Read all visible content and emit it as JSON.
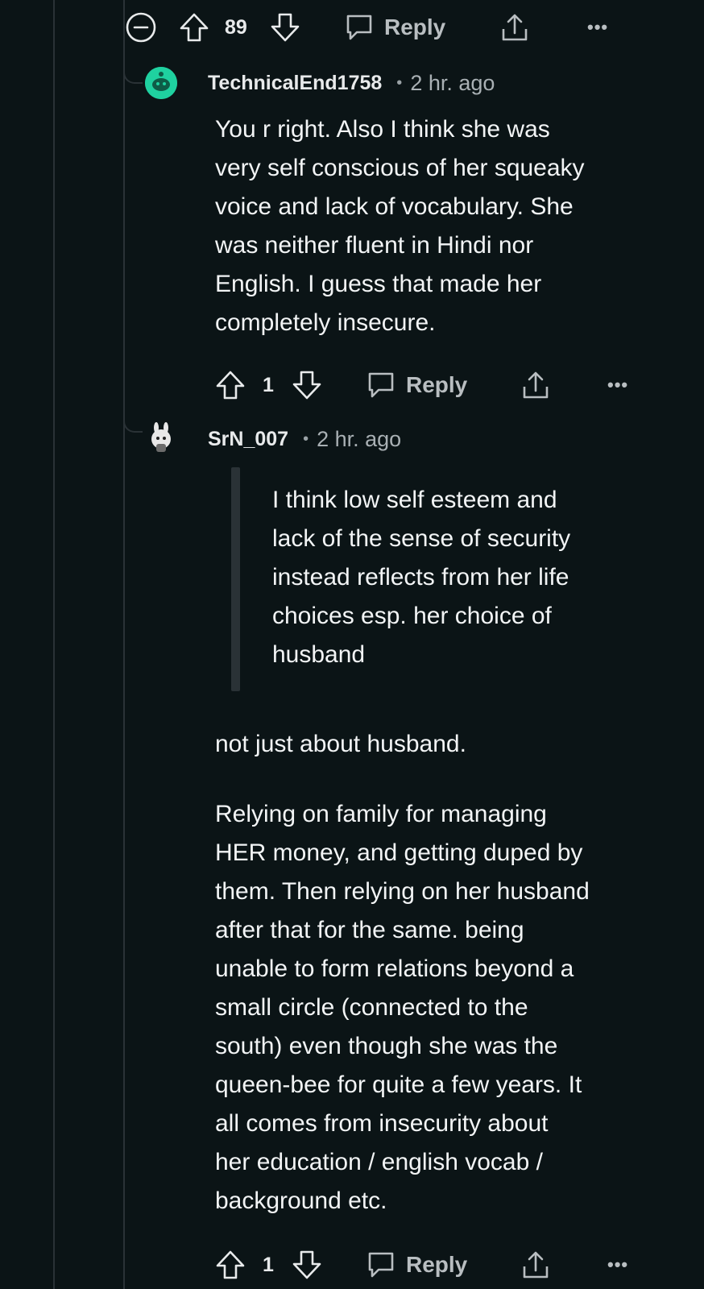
{
  "parent_comment": {
    "vote_count": "89",
    "reply_label": "Reply",
    "more_label": "•••"
  },
  "comments": [
    {
      "username": "TechnicalEnd1758",
      "separator": "•",
      "age": "2 hr. ago",
      "body": "You r right. Also I think she was\nvery self conscious of her squeaky\nvoice and lack of vocabulary. She\nwas neither fluent in Hindi nor\nEnglish. I guess that made her\ncompletely insecure.",
      "vote_count": "1",
      "reply_label": "Reply",
      "more_label": "•••",
      "avatar_icon": "snoo-avatar-teal"
    },
    {
      "username": "SrN_007",
      "separator": "•",
      "age": "2 hr. ago",
      "quote": "I think low self esteem and\nlack of the sense of security\ninstead reflects from her life\nchoices esp. her choice of\nhusband",
      "body_p1": "not just about husband.",
      "body_p2": "Relying on family for managing\nHER money, and getting duped by\nthem. Then relying on her husband\nafter that for the same. being\nunable to form relations beyond a\nsmall circle (connected to the\nsouth) even though she was the\nqueen-bee for quite a few years. It\nall comes from insecurity about\nher education / english vocab /\nbackground etc.",
      "vote_count": "1",
      "reply_label": "Reply",
      "more_label": "•••",
      "avatar_icon": "snoo-avatar-bunny"
    }
  ],
  "colors": {
    "background": "#0b1416",
    "thread_line": "#2a3236",
    "text": "#f2f4f5",
    "meta": "#a9b0b4",
    "avatar_teal": "#1fd1a0"
  }
}
